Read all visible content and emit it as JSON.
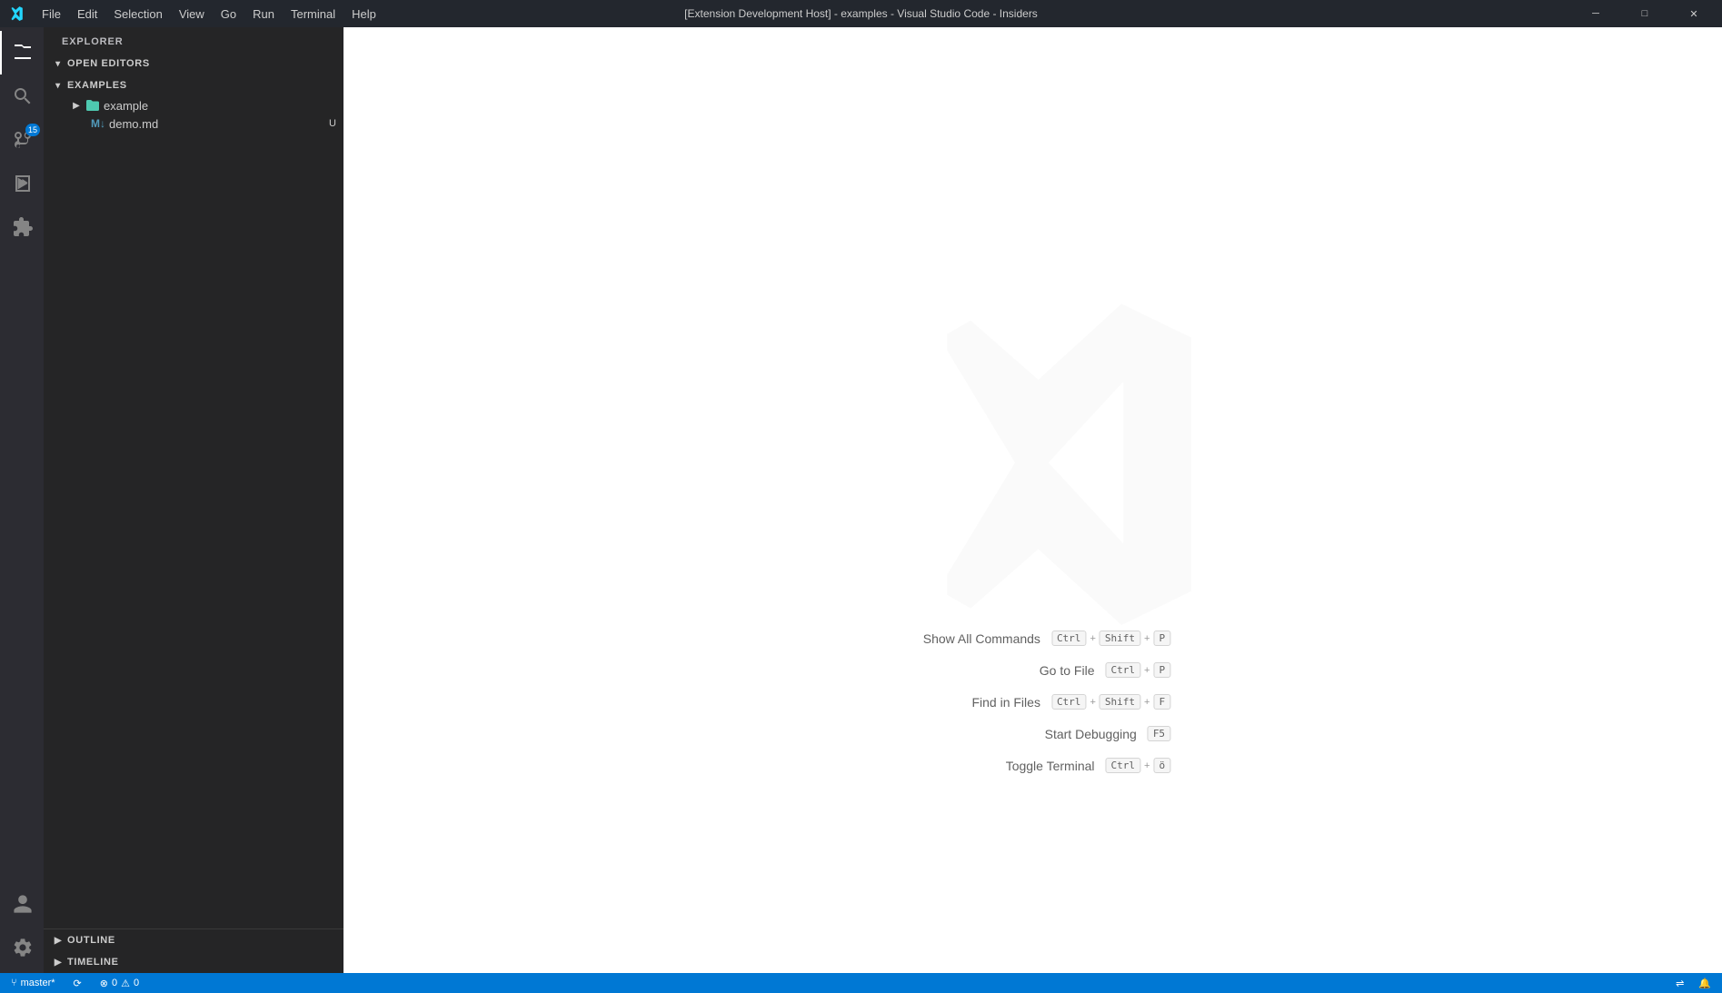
{
  "titlebar": {
    "title": "[Extension Development Host] - examples - Visual Studio Code - Insiders",
    "menu": [
      "File",
      "Edit",
      "Selection",
      "View",
      "Go",
      "Run",
      "Terminal",
      "Help"
    ],
    "controls": {
      "minimize": "─",
      "maximize": "□",
      "close": "✕"
    }
  },
  "sidebar": {
    "header": "Explorer",
    "sections": {
      "open_editors": "Open Editors",
      "examples": "Examples"
    },
    "tree": {
      "example_folder": "example",
      "example_badge": "●",
      "demo_file": "demo.md",
      "demo_badge": "U"
    },
    "footer": {
      "outline": "Outline",
      "timeline": "Timeline"
    }
  },
  "welcome": {
    "commands": [
      {
        "label": "Show All Commands",
        "keys": [
          "Ctrl",
          "+",
          "Shift",
          "+",
          "P"
        ]
      },
      {
        "label": "Go to File",
        "keys": [
          "Ctrl",
          "+",
          "P"
        ]
      },
      {
        "label": "Find in Files",
        "keys": [
          "Ctrl",
          "+",
          "Shift",
          "+",
          "F"
        ]
      },
      {
        "label": "Start Debugging",
        "keys": [
          "F5"
        ]
      },
      {
        "label": "Toggle Terminal",
        "keys": [
          "Ctrl",
          "+",
          "ö"
        ]
      }
    ]
  },
  "statusbar": {
    "branch": "master*",
    "sync_icon": "⟳",
    "errors": "0",
    "warnings": "0",
    "remote_icon": "⇌",
    "bell_icon": "🔔"
  },
  "icons": {
    "explorer": "files",
    "search": "search",
    "source_control": "git",
    "run": "play",
    "extensions": "blocks",
    "account": "person",
    "settings": "gear"
  }
}
